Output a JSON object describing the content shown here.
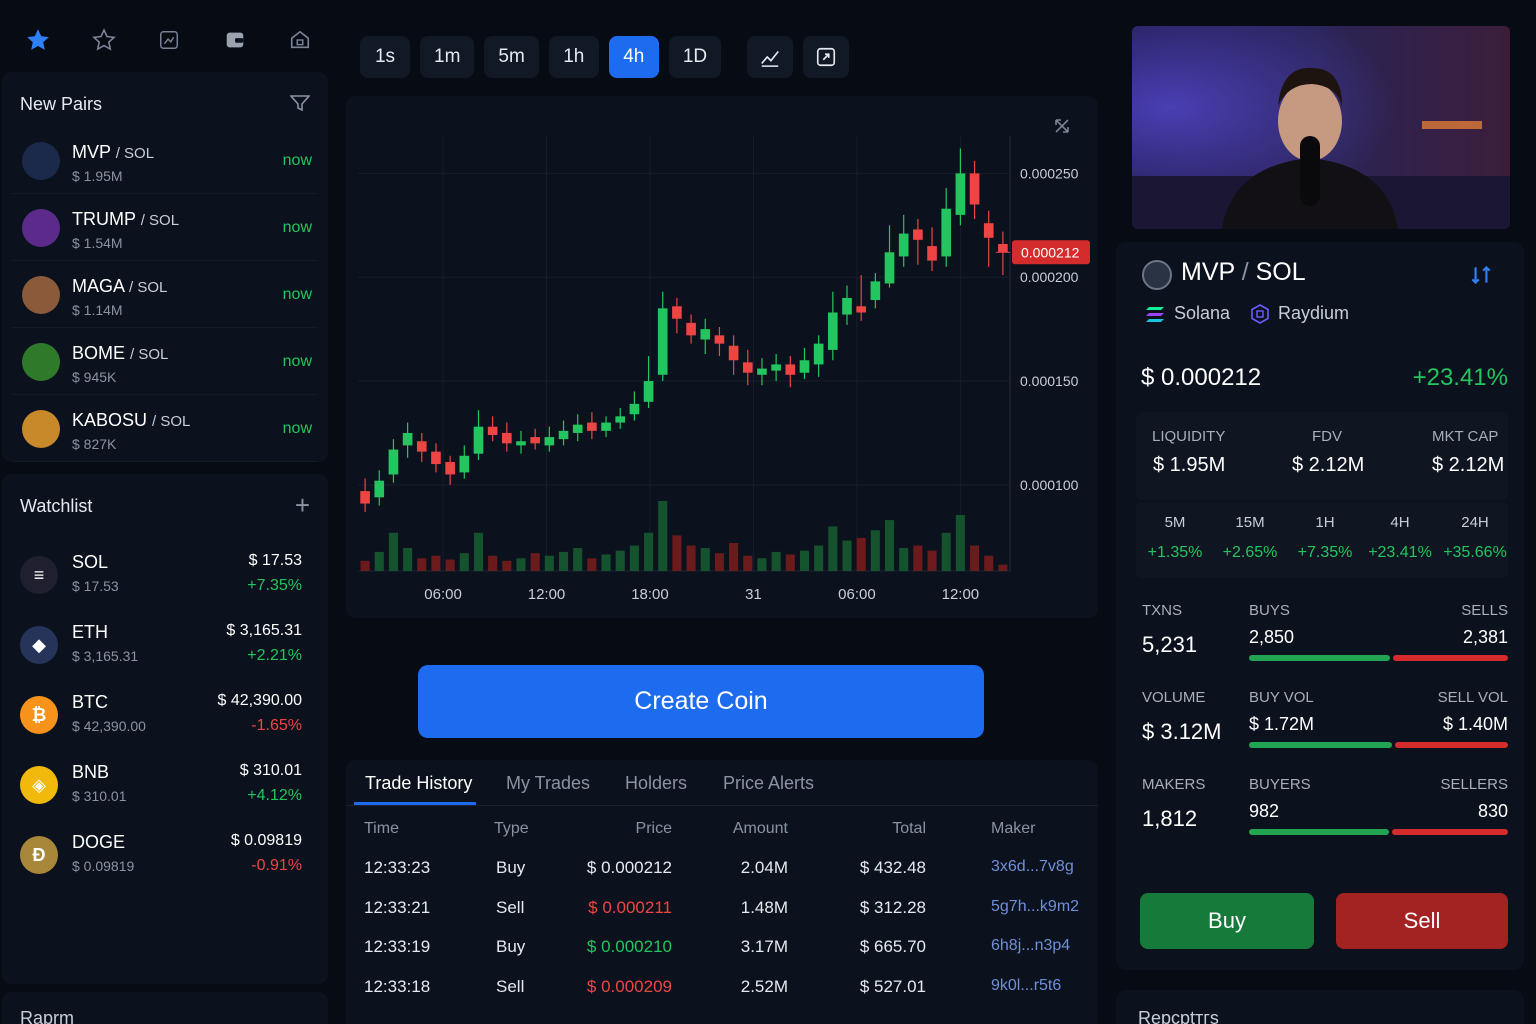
{
  "top_icons": [
    "star-filled-icon",
    "star-outline-icon",
    "chart-box-icon",
    "wallet-icon",
    "home-icon"
  ],
  "new_pairs": {
    "title": "New Pairs",
    "items": [
      {
        "name": "MVP",
        "quote": "/ SOL",
        "cap": "$ 1.95M",
        "time": "now",
        "color": "#1b2a4a"
      },
      {
        "name": "TRUMP",
        "quote": "/ SOL",
        "cap": "$ 1.54M",
        "time": "now",
        "color": "#5b2a8a"
      },
      {
        "name": "MAGA",
        "quote": "/ SOL",
        "cap": "$ 1.14M",
        "time": "now",
        "color": "#8a5a3a"
      },
      {
        "name": "BOME",
        "quote": "/ SOL",
        "cap": "$ 945K",
        "time": "now",
        "color": "#2f7a2a"
      },
      {
        "name": "KABOSU",
        "quote": "/ SOL",
        "cap": "$ 827K",
        "time": "now",
        "color": "#c7892a"
      }
    ]
  },
  "watchlist": {
    "title": "Watchlist",
    "add": "+",
    "items": [
      {
        "sym": "SOL",
        "sub": "$ 17.53",
        "price": "$ 17.53",
        "change": "+7.35%",
        "up": true,
        "color": "#1f1f2f",
        "glyph": "≡"
      },
      {
        "sym": "ETH",
        "sub": "$ 3,165.31",
        "price": "$ 3,165.31",
        "change": "+2.21%",
        "up": true,
        "color": "#26345a",
        "glyph": "◆"
      },
      {
        "sym": "BTC",
        "sub": "$ 42,390.00",
        "price": "$ 42,390.00",
        "change": "-1.65%",
        "up": false,
        "color": "#f7931a",
        "glyph": "₿"
      },
      {
        "sym": "BNB",
        "sub": "$ 310.01",
        "price": "$ 310.01",
        "change": "+4.12%",
        "up": true,
        "color": "#f0b90b",
        "glyph": "◈"
      },
      {
        "sym": "DOGE",
        "sub": "$ 0.09819",
        "price": "$ 0.09819",
        "change": "-0.91%",
        "up": false,
        "color": "#a8873a",
        "glyph": "Ð"
      }
    ]
  },
  "bottom_left_label": "Rарrm",
  "timeframes": [
    "1s",
    "1m",
    "5m",
    "1h",
    "4h",
    "1D"
  ],
  "active_timeframe": "4h",
  "chart_data": {
    "type": "candlestick",
    "y_ticks": [
      "0.000250",
      "0.000200",
      "0.000150",
      "0.000100"
    ],
    "x_ticks": [
      "06:00",
      "12:00",
      "18:00",
      "31",
      "06:00",
      "12:00"
    ],
    "last_price_label": "0.000212",
    "candles": [
      {
        "o": 9.7e-05,
        "c": 9.1e-05,
        "h": 0.000103,
        "l": 8.7e-05
      },
      {
        "o": 9.4e-05,
        "c": 0.000102,
        "h": 0.000107,
        "l": 9e-05
      },
      {
        "o": 0.000105,
        "c": 0.000117,
        "h": 0.000122,
        "l": 0.000101
      },
      {
        "o": 0.000119,
        "c": 0.000125,
        "h": 0.00013,
        "l": 0.000113
      },
      {
        "o": 0.000121,
        "c": 0.000116,
        "h": 0.000125,
        "l": 0.000111
      },
      {
        "o": 0.000116,
        "c": 0.00011,
        "h": 0.00012,
        "l": 0.000106
      },
      {
        "o": 0.000111,
        "c": 0.000105,
        "h": 0.000114,
        "l": 0.0001
      },
      {
        "o": 0.000106,
        "c": 0.000114,
        "h": 0.000119,
        "l": 0.000103
      },
      {
        "o": 0.000115,
        "c": 0.000128,
        "h": 0.000136,
        "l": 0.000112
      },
      {
        "o": 0.000128,
        "c": 0.000124,
        "h": 0.000133,
        "l": 0.000121
      },
      {
        "o": 0.000125,
        "c": 0.00012,
        "h": 0.00013,
        "l": 0.000116
      },
      {
        "o": 0.000119,
        "c": 0.000121,
        "h": 0.000126,
        "l": 0.000115
      },
      {
        "o": 0.000123,
        "c": 0.00012,
        "h": 0.000127,
        "l": 0.000117
      },
      {
        "o": 0.000119,
        "c": 0.000123,
        "h": 0.000128,
        "l": 0.000116
      },
      {
        "o": 0.000122,
        "c": 0.000126,
        "h": 0.000131,
        "l": 0.000119
      },
      {
        "o": 0.000125,
        "c": 0.000129,
        "h": 0.000134,
        "l": 0.000121
      },
      {
        "o": 0.00013,
        "c": 0.000126,
        "h": 0.000135,
        "l": 0.000122
      },
      {
        "o": 0.000126,
        "c": 0.00013,
        "h": 0.000133,
        "l": 0.000123
      },
      {
        "o": 0.00013,
        "c": 0.000133,
        "h": 0.000137,
        "l": 0.000127
      },
      {
        "o": 0.000134,
        "c": 0.000139,
        "h": 0.000145,
        "l": 0.000131
      },
      {
        "o": 0.00014,
        "c": 0.00015,
        "h": 0.000162,
        "l": 0.000137
      },
      {
        "o": 0.000153,
        "c": 0.000185,
        "h": 0.000193,
        "l": 0.00015
      },
      {
        "o": 0.000186,
        "c": 0.00018,
        "h": 0.00019,
        "l": 0.000173
      },
      {
        "o": 0.000178,
        "c": 0.000172,
        "h": 0.000182,
        "l": 0.000168
      },
      {
        "o": 0.00017,
        "c": 0.000175,
        "h": 0.00018,
        "l": 0.000163
      },
      {
        "o": 0.000172,
        "c": 0.000168,
        "h": 0.000176,
        "l": 0.000162
      },
      {
        "o": 0.000167,
        "c": 0.00016,
        "h": 0.000172,
        "l": 0.000153
      },
      {
        "o": 0.000159,
        "c": 0.000154,
        "h": 0.000165,
        "l": 0.000148
      },
      {
        "o": 0.000153,
        "c": 0.000156,
        "h": 0.000161,
        "l": 0.000148
      },
      {
        "o": 0.000155,
        "c": 0.000158,
        "h": 0.000163,
        "l": 0.00015
      },
      {
        "o": 0.000158,
        "c": 0.000153,
        "h": 0.000162,
        "l": 0.000147
      },
      {
        "o": 0.000154,
        "c": 0.00016,
        "h": 0.000166,
        "l": 0.000151
      },
      {
        "o": 0.000158,
        "c": 0.000168,
        "h": 0.000172,
        "l": 0.000152
      },
      {
        "o": 0.000165,
        "c": 0.000183,
        "h": 0.000193,
        "l": 0.00016
      },
      {
        "o": 0.000182,
        "c": 0.00019,
        "h": 0.000196,
        "l": 0.000177
      },
      {
        "o": 0.000186,
        "c": 0.000183,
        "h": 0.000201,
        "l": 0.000179
      },
      {
        "o": 0.000189,
        "c": 0.000198,
        "h": 0.000202,
        "l": 0.000185
      },
      {
        "o": 0.000197,
        "c": 0.000212,
        "h": 0.000225,
        "l": 0.000195
      },
      {
        "o": 0.00021,
        "c": 0.000221,
        "h": 0.00023,
        "l": 0.000205
      },
      {
        "o": 0.000223,
        "c": 0.000218,
        "h": 0.000228,
        "l": 0.000206
      },
      {
        "o": 0.000215,
        "c": 0.000208,
        "h": 0.000224,
        "l": 0.000203
      },
      {
        "o": 0.00021,
        "c": 0.000233,
        "h": 0.000243,
        "l": 0.000205
      },
      {
        "o": 0.00023,
        "c": 0.00025,
        "h": 0.000262,
        "l": 0.000225
      },
      {
        "o": 0.00025,
        "c": 0.000235,
        "h": 0.000256,
        "l": 0.000228
      },
      {
        "o": 0.000226,
        "c": 0.000219,
        "h": 0.000232,
        "l": 0.000205
      },
      {
        "o": 0.000216,
        "c": 0.000212,
        "h": 0.000222,
        "l": 0.000201
      }
    ],
    "volumes": [
      8,
      15,
      30,
      18,
      10,
      12,
      9,
      14,
      30,
      12,
      8,
      10,
      14,
      12,
      15,
      18,
      10,
      13,
      16,
      20,
      30,
      55,
      28,
      20,
      18,
      14,
      22,
      12,
      10,
      15,
      13,
      16,
      20,
      35,
      24,
      26,
      32,
      40,
      18,
      20,
      16,
      30,
      44,
      20,
      12,
      5
    ],
    "y_range": [
      8.5e-05,
      0.000268
    ]
  },
  "create_coin_label": "Create Coin",
  "trades": {
    "tabs": [
      "Trade History",
      "My Trades",
      "Holders",
      "Price Alerts"
    ],
    "columns": [
      "Time",
      "Type",
      "Price",
      "Amount",
      "Total",
      "Maker"
    ],
    "rows": [
      {
        "time": "12:33:23",
        "type": "Buy",
        "price": "$ 0.000212",
        "amount": "2.04M",
        "total": "$ 432.48",
        "maker": "3x6d...7v8g",
        "up": true
      },
      {
        "time": "12:33:21",
        "type": "Sell",
        "price": "$ 0.000211",
        "amount": "1.48M",
        "total": "$ 312.28",
        "maker": "5g7h...k9m2",
        "up": false
      },
      {
        "time": "12:33:19",
        "type": "Buy",
        "price": "$ 0.000210",
        "amount": "3.17M",
        "total": "$ 665.70",
        "maker": "6h8j...n3p4",
        "up": true
      },
      {
        "time": "12:33:18",
        "type": "Sell",
        "price": "$ 0.000209",
        "amount": "2.52M",
        "total": "$ 527.01",
        "maker": "9k0l...r5t6",
        "up": false
      }
    ]
  },
  "token": {
    "name": "MVP",
    "pair_sep": "/",
    "quote": "SOL",
    "chain": "Solana",
    "dex": "Raydium",
    "price": "$ 0.000212",
    "change": "+23.41%",
    "stats": [
      {
        "label": "LIQUIDITY",
        "value": "$ 1.95M"
      },
      {
        "label": "FDV",
        "value": "$ 2.12M"
      },
      {
        "label": "MKT CAP",
        "value": "$ 2.12M"
      }
    ],
    "periods": [
      {
        "label": "5M",
        "value": "+1.35%"
      },
      {
        "label": "15M",
        "value": "+2.65%"
      },
      {
        "label": "1H",
        "value": "+7.35%"
      },
      {
        "label": "4H",
        "value": "+23.41%"
      },
      {
        "label": "24H",
        "value": "+35.66%"
      }
    ],
    "txns": {
      "label": "TXNS",
      "value": "5,231",
      "left_label": "BUYS",
      "left": "2,850",
      "right_label": "SELLS",
      "right": "2,381",
      "ratio": 0.545
    },
    "volume": {
      "label": "VOLUME",
      "value": "$ 3.12M",
      "left_label": "BUY VOL",
      "left": "$ 1.72M",
      "right_label": "SELL VOL",
      "right": "$ 1.40M",
      "ratio": 0.551
    },
    "makers": {
      "label": "MAKERS",
      "value": "1,812",
      "left_label": "BUYERS",
      "left": "982",
      "right_label": "SELLERS",
      "right": "830",
      "ratio": 0.542
    },
    "buy_label": "Buy",
    "sell_label": "Sell"
  },
  "bottom_right_label": "Rерсрtтгs",
  "colors": {
    "accent": "#1d6cf0",
    "up": "#22c55e",
    "down": "#ef4444"
  }
}
